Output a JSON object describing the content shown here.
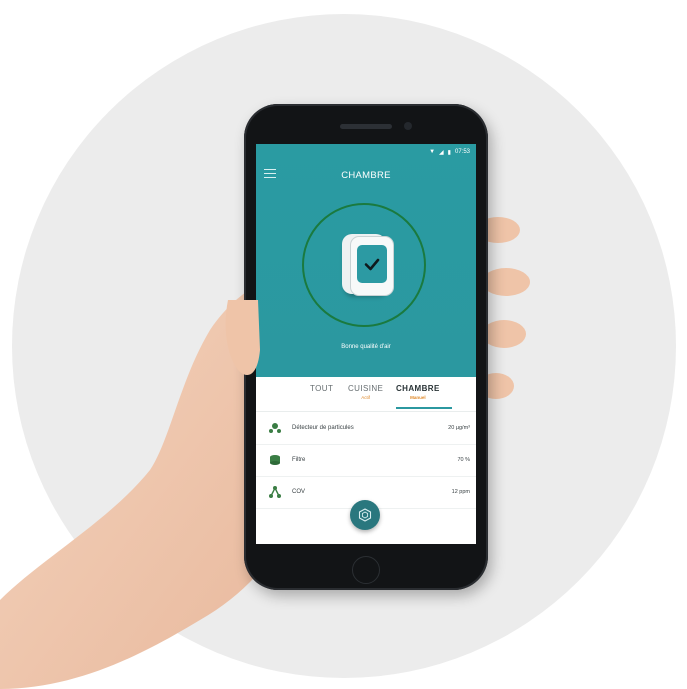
{
  "status_bar": {
    "time": "07:53",
    "icons": [
      "wifi-icon",
      "signal-icon",
      "battery-icon"
    ]
  },
  "header": {
    "title": "CHAMBRE",
    "menu_icon": "hamburger-menu-icon"
  },
  "hero": {
    "status_text": "Bonne qualité d'air",
    "icon": "check-icon"
  },
  "tabs": [
    {
      "label": "TOUT",
      "sub": ""
    },
    {
      "label": "CUISINE",
      "sub": "Actif"
    },
    {
      "label": "CHAMBRE",
      "sub": "Manuel",
      "active": true
    }
  ],
  "sensors": [
    {
      "label": "Détecteur de particules",
      "value": "20 µg/m³",
      "icon": "particle-sensor-icon"
    },
    {
      "label": "Filtre",
      "value": "70 %",
      "icon": "filter-icon"
    },
    {
      "label": "COV",
      "value": "12 ppm",
      "icon": "molecule-icon"
    }
  ],
  "fab_icon": "hexagon-icon",
  "colors": {
    "teal": "#2b98a0",
    "ring": "#1a7a3f",
    "accent_orange": "#e08a2b",
    "icon_green": "#3a7d44"
  }
}
